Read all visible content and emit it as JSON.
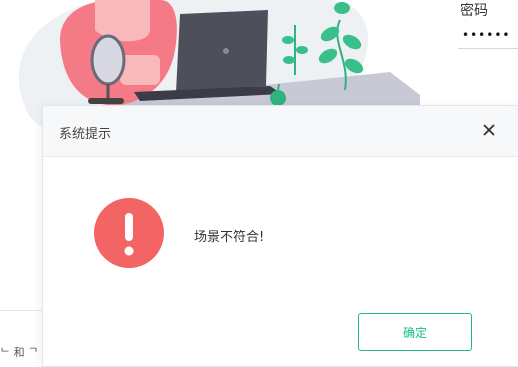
{
  "login": {
    "password_label": "密码",
    "password_value": "••••••"
  },
  "footer": {
    "partial_text": "ᄂ 和 ᄀ"
  },
  "dialog": {
    "title": "系统提示",
    "message": "场景不符合!",
    "ok_label": "确定"
  },
  "icons": {
    "close": "close-icon",
    "error": "error-icon"
  },
  "colors": {
    "accent": "#1bbd7d",
    "error": "#f36565",
    "header_bg": "#f7f8fa"
  }
}
